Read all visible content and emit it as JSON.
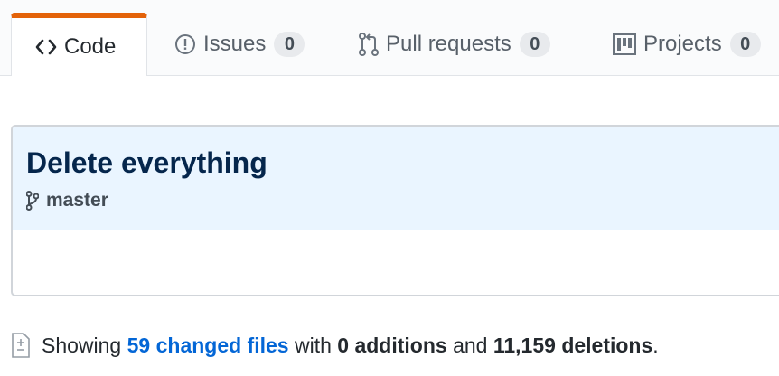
{
  "tabs": [
    {
      "label": "Code",
      "icon": "code-icon",
      "selected": true
    },
    {
      "label": "Issues",
      "icon": "issue-opened-icon",
      "count": "0"
    },
    {
      "label": "Pull requests",
      "icon": "git-pull-request-icon",
      "count": "0"
    },
    {
      "label": "Projects",
      "icon": "project-icon",
      "count": "0"
    }
  ],
  "commit": {
    "title": "Delete everything",
    "branch": "master",
    "branch_icon": "git-branch-icon"
  },
  "summary": {
    "icon": "diff-icon",
    "prefix": "Showing",
    "changed_files": "59 changed files",
    "with_text": "with",
    "additions": "0 additions",
    "and_text": "and",
    "deletions": "11,159 deletions",
    "suffix": "."
  },
  "colors": {
    "accent_tab": "#e36209",
    "link": "#0366d6",
    "commit_bg": "#eaf5ff",
    "title": "#05264c"
  }
}
